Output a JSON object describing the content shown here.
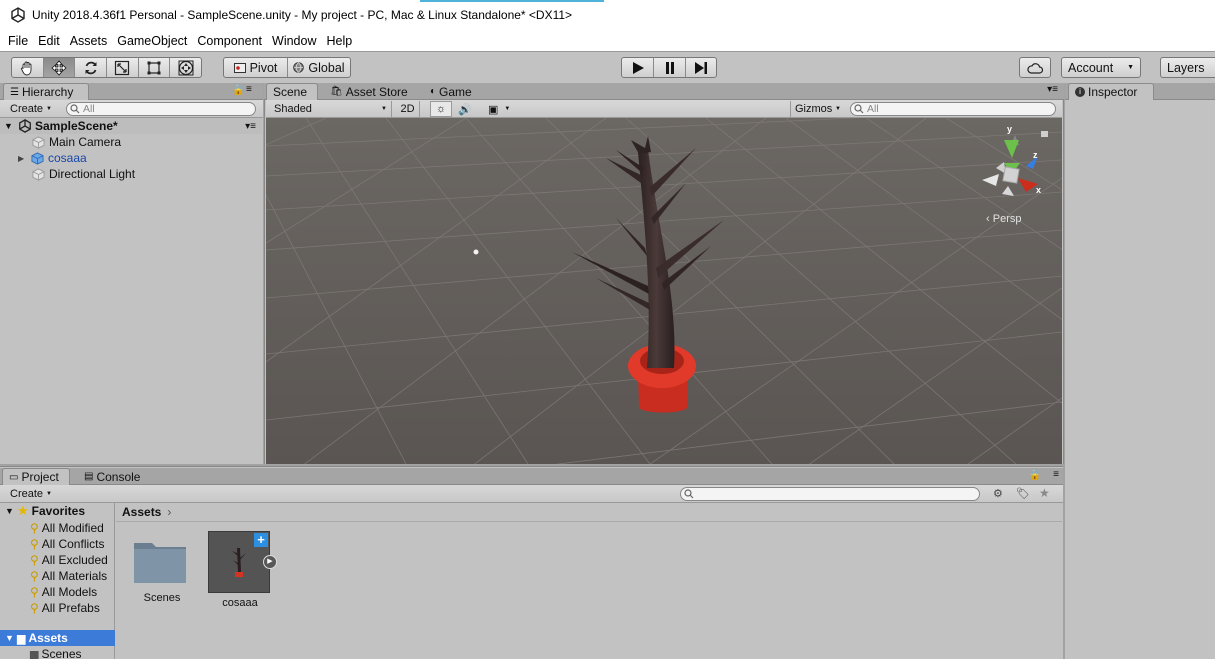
{
  "window": {
    "title": "Unity 2018.4.36f1 Personal - SampleScene.unity - My project - PC, Mac & Linux Standalone* <DX11>"
  },
  "menu": [
    "File",
    "Edit",
    "Assets",
    "GameObject",
    "Component",
    "Window",
    "Help"
  ],
  "toolbar": {
    "transform_tools": [
      "hand-tool-icon",
      "move-tool-icon",
      "rotate-tool-icon",
      "scale-tool-icon",
      "rect-tool-icon",
      "transform-tool-icon"
    ],
    "pivot_label": "Pivot",
    "global_label": "Global",
    "account_label": "Account",
    "layers_label": "Layers"
  },
  "hierarchy": {
    "tab_label": "Hierarchy",
    "create_label": "Create",
    "search_placeholder": "All",
    "scene_name": "SampleScene*",
    "items": [
      {
        "name": "Main Camera"
      },
      {
        "name": "cosaaa"
      },
      {
        "name": "Directional Light"
      }
    ]
  },
  "scene_tabs": {
    "scene": "Scene",
    "asset_store": "Asset Store",
    "game": "Game"
  },
  "scene_bar": {
    "shading": "Shaded",
    "mode_2d": "2D",
    "gizmos": "Gizmos",
    "search_placeholder": "All"
  },
  "scene_view": {
    "gizmo_axes": {
      "y": "y",
      "z": "z",
      "x": "x"
    },
    "persp_label": "Persp"
  },
  "inspector": {
    "tab_label": "Inspector"
  },
  "project": {
    "tabs": {
      "project": "Project",
      "console": "Console"
    },
    "create_label": "Create",
    "favorites_label": "Favorites",
    "favorites": [
      "All Modified",
      "All Conflicts",
      "All Excluded",
      "All Materials",
      "All Models",
      "All Prefabs"
    ],
    "assets_root": "Assets",
    "tree_child": "Scenes",
    "breadcrumb": "Assets",
    "items": [
      {
        "name": "Scenes"
      },
      {
        "name": "cosaaa"
      }
    ]
  },
  "colors": {
    "panel": "#c2c2c2",
    "tab_strip": "#a5a5a5",
    "scene_bg": "#5e5955",
    "pot_red": "#e23a2a",
    "bark": "#3a2c2c",
    "selection": "#3d7bd8"
  }
}
